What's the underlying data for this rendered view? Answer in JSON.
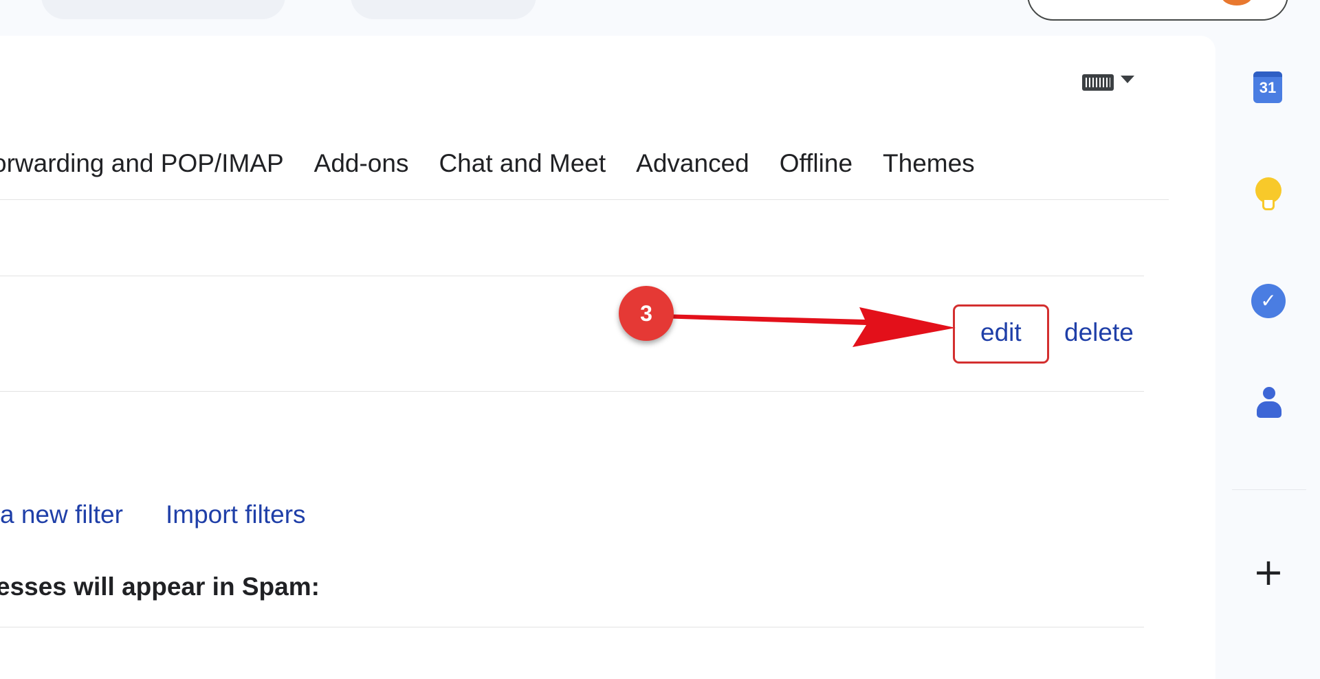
{
  "tabs": [
    {
      "label": "orwarding and POP/IMAP"
    },
    {
      "label": "Add-ons"
    },
    {
      "label": "Chat and Meet"
    },
    {
      "label": "Advanced"
    },
    {
      "label": "Offline"
    },
    {
      "label": "Themes"
    }
  ],
  "filter_row": {
    "edit_label": "edit",
    "delete_label": "delete"
  },
  "filter_actions": {
    "create_label": "a new filter",
    "import_label": "Import filters"
  },
  "blocked_heading": "esses will appear in Spam:",
  "annotation": {
    "step_number": "3",
    "color": "#e53935"
  },
  "side_panel": {
    "calendar_day": "31",
    "tasks_glyph": "✓",
    "add_glyph": "+",
    "icons": [
      "calendar-icon",
      "keep-icon",
      "tasks-icon",
      "contacts-icon",
      "plus-icon"
    ]
  },
  "colors": {
    "link": "#1f3fa8",
    "text": "#202124",
    "accent_blue": "#4a7de2",
    "keep_yellow": "#f8c92a"
  }
}
